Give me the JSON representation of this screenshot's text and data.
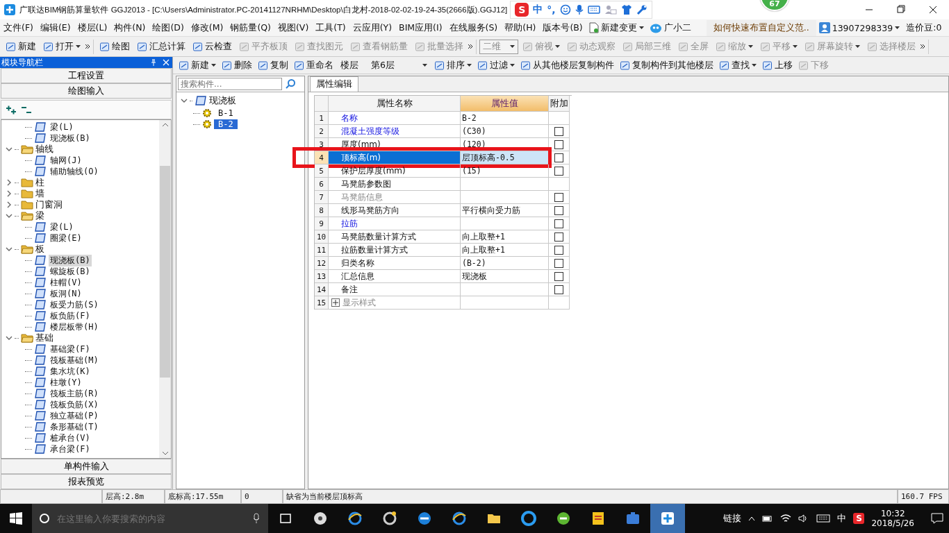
{
  "title_bar": {
    "title": "广联达BIM钢筋算量软件 GGJ2013 - [C:\\Users\\Administrator.PC-20141127NRHM\\Desktop\\白龙村-2018-02-02-19-24-35(2666版).GGJ12]",
    "ime": {
      "logo": "S",
      "mode": "中",
      "punct": "°,"
    },
    "badge": "67"
  },
  "menu": {
    "items": [
      "文件(F)",
      "编辑(E)",
      "楼层(L)",
      "构件(N)",
      "绘图(D)",
      "修改(M)",
      "钢筋量(Q)",
      "视图(V)",
      "工具(T)",
      "云应用(Y)",
      "BIM应用(I)",
      "在线服务(S)",
      "帮助(H)",
      "版本号(B)"
    ],
    "change": "新建变更",
    "assistant": "广小二",
    "tip": "如何快速布置自定义范..",
    "account": "13907298339",
    "beans": "造价豆:0"
  },
  "toolbar": [
    {
      "items": [
        {
          "label": "新建",
          "disabled": false,
          "dropdown": false
        },
        {
          "label": "打开",
          "disabled": false,
          "dropdown": true
        }
      ]
    },
    {
      "items": [
        {
          "label": "绘图",
          "disabled": false,
          "dropdown": false
        },
        {
          "label": "汇总计算",
          "disabled": false,
          "dropdown": false
        },
        {
          "label": "云检查",
          "disabled": false,
          "dropdown": false
        },
        {
          "label": "平齐板顶",
          "disabled": true,
          "dropdown": false
        },
        {
          "label": "查找图元",
          "disabled": true,
          "dropdown": false
        },
        {
          "label": "查看钢筋量",
          "disabled": true,
          "dropdown": false
        },
        {
          "label": "批量选择",
          "disabled": true,
          "dropdown": false
        }
      ]
    },
    {
      "items": [
        {
          "label": "二维",
          "disabled": true,
          "dropdown": true,
          "kind": "select"
        },
        {
          "label": "俯视",
          "disabled": true,
          "dropdown": true
        },
        {
          "label": "动态观察",
          "disabled": true,
          "dropdown": false
        },
        {
          "label": "局部三维",
          "disabled": true,
          "dropdown": false
        },
        {
          "label": "全屏",
          "disabled": true,
          "dropdown": false
        },
        {
          "label": "缩放",
          "disabled": true,
          "dropdown": true
        },
        {
          "label": "平移",
          "disabled": true,
          "dropdown": true
        },
        {
          "label": "屏幕旋转",
          "disabled": true,
          "dropdown": true
        },
        {
          "label": "选择楼层",
          "disabled": true,
          "dropdown": false
        }
      ]
    }
  ],
  "nav": {
    "title": "模块导航栏",
    "top_buttons": [
      "工程设置",
      "绘图输入"
    ],
    "bottom_buttons": [
      "单构件输入",
      "报表预览"
    ],
    "tree": [
      {
        "label": "梁(L)",
        "selected": false
      },
      {
        "label": "现浇板(B)",
        "selected": false
      },
      {
        "label": "轴线",
        "expanded": true,
        "children": [
          {
            "label": "轴网(J)",
            "selected": false
          },
          {
            "label": "辅助轴线(O)",
            "selected": false
          }
        ]
      },
      {
        "label": "柱",
        "expanded": false
      },
      {
        "label": "墙",
        "expanded": false
      },
      {
        "label": "门窗洞",
        "expanded": false
      },
      {
        "label": "梁",
        "expanded": true,
        "children": [
          {
            "label": "梁(L)",
            "selected": false
          },
          {
            "label": "圈梁(E)",
            "selected": false
          }
        ]
      },
      {
        "label": "板",
        "expanded": true,
        "children": [
          {
            "label": "现浇板(B)",
            "selected": true
          },
          {
            "label": "螺旋板(B)",
            "selected": false
          },
          {
            "label": "柱帽(V)",
            "selected": false
          },
          {
            "label": "板洞(N)",
            "selected": false
          },
          {
            "label": "板受力筋(S)",
            "selected": false
          },
          {
            "label": "板负筋(F)",
            "selected": false
          },
          {
            "label": "楼层板带(H)",
            "selected": false
          }
        ]
      },
      {
        "label": "基础",
        "expanded": true,
        "children": [
          {
            "label": "基础梁(F)",
            "selected": false
          },
          {
            "label": "筏板基础(M)",
            "selected": false
          },
          {
            "label": "集水坑(K)",
            "selected": false
          },
          {
            "label": "柱墩(Y)",
            "selected": false
          },
          {
            "label": "筏板主筋(R)",
            "selected": false
          },
          {
            "label": "筏板负筋(X)",
            "selected": false
          },
          {
            "label": "独立基础(P)",
            "selected": false
          },
          {
            "label": "条形基础(T)",
            "selected": false
          },
          {
            "label": "桩承台(V)",
            "selected": false
          },
          {
            "label": "承台梁(F)",
            "selected": false
          }
        ]
      }
    ]
  },
  "component_toolbar": {
    "items": [
      {
        "label": "新建",
        "disabled": false,
        "dropdown": true
      },
      {
        "label": "删除",
        "disabled": false,
        "dropdown": false
      },
      {
        "label": "复制",
        "disabled": false,
        "dropdown": false
      },
      {
        "label": "重命名",
        "disabled": false,
        "dropdown": false
      }
    ],
    "floor_label": "楼层",
    "floor": "第6层",
    "items2": [
      {
        "label": "排序",
        "disabled": false,
        "dropdown": true
      },
      {
        "label": "过滤",
        "disabled": false,
        "dropdown": true
      },
      {
        "label": "从其他楼层复制构件",
        "disabled": false,
        "dropdown": false
      },
      {
        "label": "复制构件到其他楼层",
        "disabled": false,
        "dropdown": false
      },
      {
        "label": "查找",
        "disabled": false,
        "dropdown": true
      },
      {
        "label": "上移",
        "disabled": false,
        "dropdown": false
      },
      {
        "label": "下移",
        "disabled": true,
        "dropdown": false
      }
    ]
  },
  "components": {
    "search": {
      "placeholder": "搜索构件..."
    },
    "tree": [
      {
        "label": "现浇板",
        "expanded": true,
        "children": [
          {
            "label": "B-1",
            "selected": false
          },
          {
            "label": "B-2",
            "selected": true
          }
        ]
      }
    ]
  },
  "properties": {
    "tab": "属性编辑",
    "columns": [
      "属性名称",
      "属性值",
      "附加"
    ],
    "rows": [
      {
        "num": "1",
        "name": "名称",
        "kind": "link",
        "value": "B-2",
        "selected": false,
        "highlighted": false
      },
      {
        "num": "2",
        "name": "混凝土强度等级",
        "kind": "link",
        "value": "(C30)",
        "checked": false,
        "selected": false,
        "highlighted": false
      },
      {
        "num": "3",
        "name": "厚度(mm)",
        "kind": "normal",
        "value": "(120)",
        "checked": false,
        "selected": false,
        "highlighted": false
      },
      {
        "num": "4",
        "name": "顶标高(m)",
        "kind": "link",
        "value": "层顶标高-0.5",
        "checked": false,
        "selected": true,
        "highlighted": true
      },
      {
        "num": "5",
        "name": "保护层厚度(mm)",
        "kind": "normal",
        "value": "(15)",
        "checked": false,
        "selected": false,
        "highlighted": false
      },
      {
        "num": "6",
        "name": "马凳筋参数图",
        "kind": "normal",
        "selected": false,
        "highlighted": false
      },
      {
        "num": "7",
        "name": "马凳筋信息",
        "kind": "disabled",
        "checked": false,
        "selected": false,
        "highlighted": false
      },
      {
        "num": "8",
        "name": "线形马凳筋方向",
        "kind": "normal",
        "value": "平行横向受力筋",
        "checked": false,
        "selected": false,
        "highlighted": false
      },
      {
        "num": "9",
        "name": "拉筋",
        "kind": "link",
        "checked": false,
        "selected": false,
        "highlighted": false
      },
      {
        "num": "10",
        "name": "马凳筋数量计算方式",
        "kind": "normal",
        "value": "向上取整+1",
        "checked": false,
        "selected": false,
        "highlighted": false
      },
      {
        "num": "11",
        "name": "拉筋数量计算方式",
        "kind": "normal",
        "value": "向上取整+1",
        "checked": false,
        "selected": false,
        "highlighted": false
      },
      {
        "num": "12",
        "name": "归类名称",
        "kind": "normal",
        "value": "(B-2)",
        "checked": false,
        "selected": false,
        "highlighted": false
      },
      {
        "num": "13",
        "name": "汇总信息",
        "kind": "normal",
        "value": "现浇板",
        "checked": false,
        "selected": false,
        "highlighted": false
      },
      {
        "num": "14",
        "name": "备注",
        "kind": "normal",
        "checked": false,
        "selected": false,
        "highlighted": false
      },
      {
        "num": "15",
        "name": "显示样式",
        "kind": "disabled",
        "expanded": false,
        "selected": false,
        "highlighted": false
      }
    ]
  },
  "status_bar": {
    "cells": [
      "层高:2.8m",
      "底标高:17.55m",
      "0",
      "缺省为当前楼层顶标高"
    ],
    "fps": "160.7 FPS"
  },
  "taskbar": {
    "search": {
      "placeholder": "在这里输入你要搜索的内容"
    },
    "apps": [
      {
        "kind": "task-view",
        "selected": false
      },
      {
        "kind": "fan",
        "selected": false
      },
      {
        "kind": "ie",
        "selected": false
      },
      {
        "kind": "swirl",
        "selected": false
      },
      {
        "kind": "edge",
        "selected": false
      },
      {
        "kind": "ie",
        "selected": false
      },
      {
        "kind": "folder",
        "selected": false
      },
      {
        "kind": "g",
        "selected": false
      },
      {
        "kind": "green",
        "selected": false
      },
      {
        "kind": "note",
        "selected": false
      },
      {
        "kind": "case",
        "selected": false
      },
      {
        "kind": "cross",
        "selected": true
      }
    ],
    "link": "链接",
    "ime": "中",
    "ime_logo": "S",
    "time": "10:32",
    "date": "2018/5/26"
  }
}
